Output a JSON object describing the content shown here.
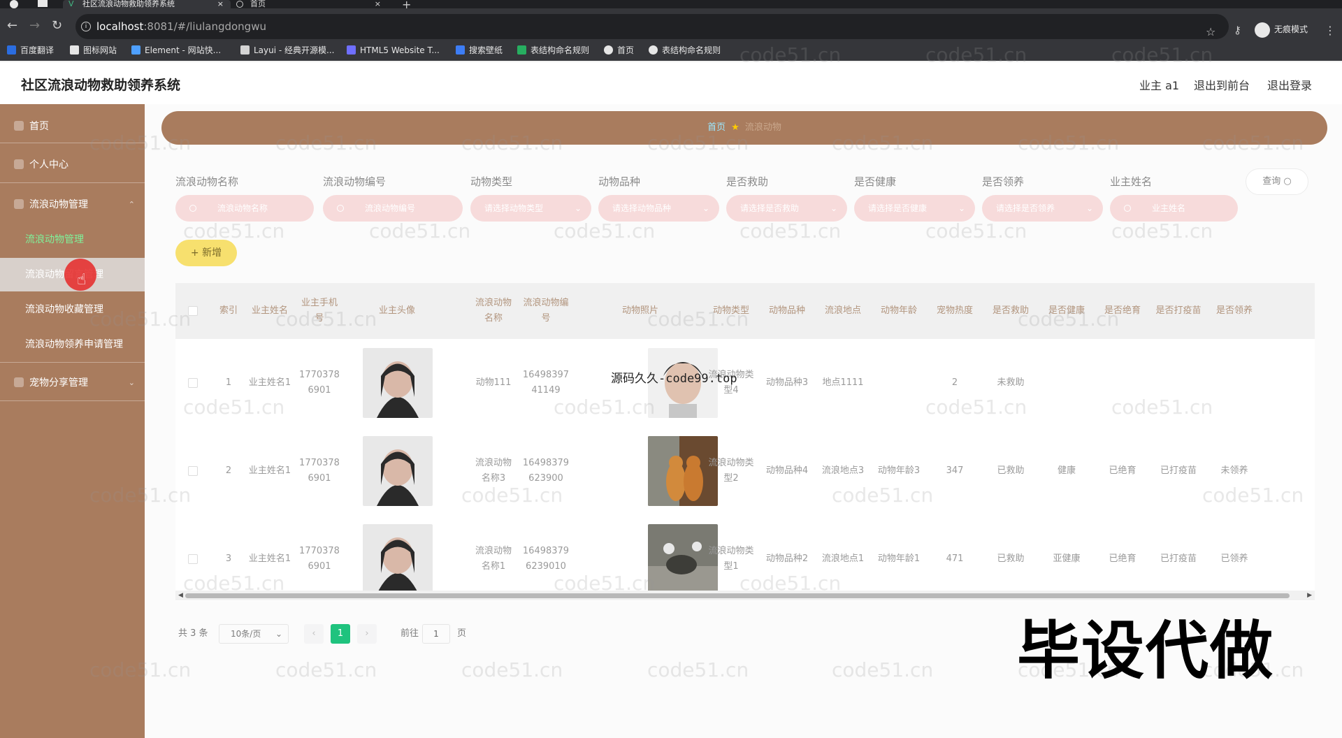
{
  "browser": {
    "tabs": [
      {
        "label": "社区流浪动物救助领养系统",
        "close": "×"
      },
      {
        "label": "首页",
        "close": "×"
      }
    ],
    "new_tab": "+",
    "url_host": "localhost",
    "url_path": ":8081/#/liulangdongwu",
    "incognito_label": "无痕模式",
    "bookmarks": [
      {
        "label": "百度翻译",
        "color": "#2b6de0"
      },
      {
        "label": "图标网站",
        "color": "#e6e6e6"
      },
      {
        "label": "Element - 网站快...",
        "color": "#4ea0ff"
      },
      {
        "label": "Layui - 经典开源模...",
        "color": "#d4d4d4"
      },
      {
        "label": "HTML5 Website T...",
        "color": "#6f6fff"
      },
      {
        "label": "搜索壁纸",
        "color": "#3d7df5"
      },
      {
        "label": "表结构命名规则",
        "color": "#27ae60"
      },
      {
        "label": "首页",
        "color": "#e6e6e6"
      },
      {
        "label": "表结构命名规则",
        "color": "#e6e6e6"
      }
    ]
  },
  "header": {
    "title": "社区流浪动物救助领养系统",
    "user": "业主 a1",
    "to_front": "退出到前台",
    "logout": "退出登录"
  },
  "sidebar": {
    "items": [
      {
        "label": "首页"
      },
      {
        "label": "个人中心"
      },
      {
        "label": "流浪动物管理"
      },
      {
        "label": "流浪动物管理"
      },
      {
        "label": "流浪动物留言管理"
      },
      {
        "label": "流浪动物收藏管理"
      },
      {
        "label": "流浪动物领养申请管理"
      },
      {
        "label": "宠物分享管理"
      }
    ]
  },
  "breadcrumb": {
    "home": "首页",
    "current": "流浪动物"
  },
  "filters": [
    {
      "label": "流浪动物名称",
      "placeholder": "流浪动物名称"
    },
    {
      "label": "流浪动物编号",
      "placeholder": "流浪动物编号"
    },
    {
      "label": "动物类型",
      "placeholder": "请选择动物类型"
    },
    {
      "label": "动物品种",
      "placeholder": "请选择动物品种"
    },
    {
      "label": "是否救助",
      "placeholder": "请选择是否救助"
    },
    {
      "label": "是否健康",
      "placeholder": "请选择是否健康"
    },
    {
      "label": "是否领养",
      "placeholder": "请选择是否领养"
    },
    {
      "label": "业主姓名",
      "placeholder": "业主姓名"
    }
  ],
  "query_label": "查询",
  "add_label": "+ 新增",
  "table": {
    "columns": [
      "索引",
      "业主姓名",
      "业主手机号",
      "业主头像",
      "流浪动物名称",
      "流浪动物编号",
      "动物照片",
      "动物类型",
      "动物品种",
      "流浪地点",
      "动物年龄",
      "宠物热度",
      "是否救助",
      "是否健康",
      "是否绝育",
      "是否打疫苗",
      "是否领养"
    ],
    "rows": [
      {
        "index": "1",
        "owner": "业主姓名1",
        "phone": "17703786901",
        "name": "动物111",
        "code": "1649839741149",
        "type": "流浪动物类型4",
        "breed": "动物品种3",
        "place": "地点1111",
        "age": "",
        "heat": "2",
        "rescued": "未救助",
        "healthy": "",
        "sterilized": "",
        "vaccinated": "",
        "adopted": "",
        "photo_colors": [
          "#2a2a2a",
          "#d9b8a8",
          "#f0f0f0",
          "#c7c7c7"
        ]
      },
      {
        "index": "2",
        "owner": "业主姓名1",
        "phone": "17703786901",
        "name": "流浪动物名称3",
        "code": "16498379623900",
        "type": "流浪动物类型2",
        "breed": "动物品种4",
        "place": "流浪地点3",
        "age": "动物年龄3",
        "heat": "347",
        "rescued": "已救助",
        "healthy": "健康",
        "sterilized": "已绝育",
        "vaccinated": "已打疫苗",
        "adopted": "未领养",
        "photo_colors": [
          "#2a2a2a",
          "#d9b8a8",
          "#6a4a30",
          "#d28a3c"
        ]
      },
      {
        "index": "3",
        "owner": "业主姓名1",
        "phone": "17703786901",
        "name": "流浪动物名称1",
        "code": "164983796239010",
        "type": "流浪动物类型1",
        "breed": "动物品种2",
        "place": "流浪地点1",
        "age": "动物年龄1",
        "heat": "471",
        "rescued": "已救助",
        "healthy": "亚健康",
        "sterilized": "已绝育",
        "vaccinated": "已打疫苗",
        "adopted": "已领养",
        "photo_colors": [
          "#2a2a2a",
          "#d9b8a8",
          "#7a7a72",
          "#3d3d38"
        ]
      }
    ]
  },
  "pagination": {
    "total": "共 3 条",
    "page_size": "10条/页",
    "prev": "‹",
    "current": "1",
    "next": "›",
    "goto_label": "前往",
    "goto_value": "1",
    "page_unit": "页"
  },
  "watermark": "code51.cn",
  "overlay_text": "源码久久-code99.top",
  "overlay_big": "毕设代做",
  "colors": {
    "sidebar": "#a97c5e",
    "active": "#d8d0cb",
    "accent": "#1fc37e",
    "header_text": "#b2957e"
  }
}
